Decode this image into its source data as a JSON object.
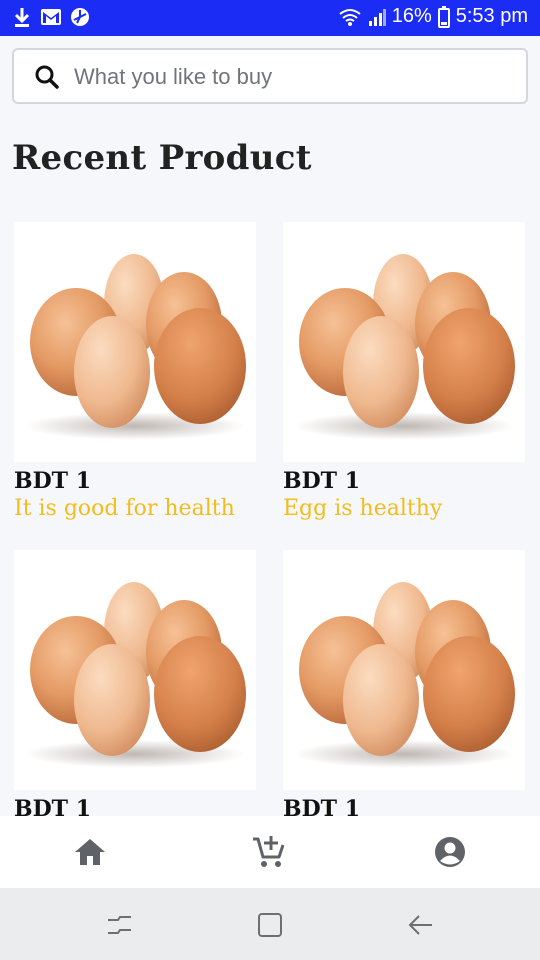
{
  "status_bar": {
    "battery": "16%",
    "time": "5:53 pm",
    "icons": [
      "download-icon",
      "gmail-icon",
      "sync-icon",
      "wifi-icon",
      "signal-icon",
      "battery-icon"
    ]
  },
  "search": {
    "placeholder": "What you like to buy",
    "icon": "search-icon"
  },
  "section_title": "Recent Product",
  "products": [
    {
      "price": "BDT 1",
      "description": "It is good for health",
      "image": "eggs-image"
    },
    {
      "price": "BDT 1",
      "description": "Egg is healthy",
      "image": "eggs-image"
    },
    {
      "price": "BDT 1",
      "description": "",
      "image": "eggs-image"
    },
    {
      "price": "BDT 1",
      "description": "",
      "image": "eggs-image"
    }
  ],
  "bottom_nav": {
    "items": [
      "home-icon",
      "add-to-cart-icon",
      "account-icon"
    ],
    "color": "#5f6368"
  },
  "system_nav": {
    "items": [
      "recents-icon",
      "home-square-icon",
      "back-icon"
    ]
  },
  "colors": {
    "status_bar": "#1b2cf5",
    "description_text": "#f2bd1a",
    "background": "#f6f7fb"
  }
}
